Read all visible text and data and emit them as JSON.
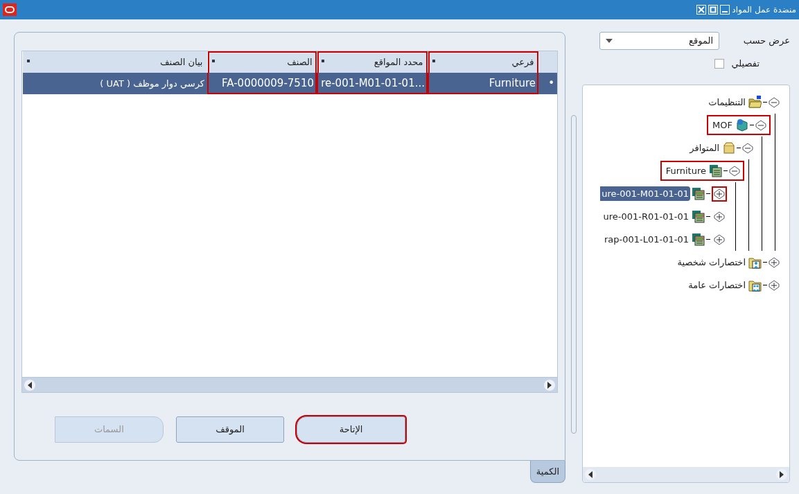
{
  "window": {
    "title": "منضدة عمل المواد"
  },
  "view_by": {
    "label": "عرض حسب",
    "value": "الموقع"
  },
  "details": {
    "label": "تفصيلي",
    "checked": false
  },
  "tree": [
    {
      "label": "التنظيمات",
      "kind": "root",
      "expanded": true,
      "selected": false,
      "highlighted": false,
      "children": [
        {
          "label": "MOF",
          "kind": "org",
          "expanded": true,
          "selected": false,
          "highlighted": true,
          "children": [
            {
              "label": "المتوافر",
              "kind": "stock",
              "expanded": true,
              "selected": false,
              "highlighted": false,
              "children": [
                {
                  "label": "Furniture",
                  "kind": "subinv",
                  "expanded": true,
                  "selected": false,
                  "highlighted": true,
                  "children": [
                    {
                      "label": "ure-001-M01-01-01",
                      "kind": "locator",
                      "expanded": false,
                      "selected": true,
                      "highlighted": false,
                      "toggle_highlighted": true
                    },
                    {
                      "label": "ure-001-R01-01-01",
                      "kind": "locator",
                      "expanded": false,
                      "selected": false,
                      "highlighted": false,
                      "toggle_highlighted": false
                    },
                    {
                      "label": "rap-001-L01-01-01",
                      "kind": "locator",
                      "expanded": false,
                      "selected": false,
                      "highlighted": false,
                      "toggle_highlighted": false
                    }
                  ]
                }
              ]
            }
          ]
        }
      ]
    },
    {
      "label": "اختصارات شخصية",
      "kind": "personal",
      "expanded": false,
      "selected": false,
      "highlighted": false
    },
    {
      "label": "اختصارات عامة",
      "kind": "public",
      "expanded": false,
      "selected": false,
      "highlighted": false
    }
  ],
  "table": {
    "columns": [
      {
        "label": "فرعي",
        "highlighted": true
      },
      {
        "label": "محدد المواقع",
        "highlighted": true
      },
      {
        "label": "الصنف",
        "highlighted": true
      },
      {
        "label": "بيان الصنف",
        "highlighted": false
      }
    ],
    "rows": [
      {
        "selected": true,
        "marker": "•",
        "cells": [
          "Furniture",
          "re-001-M01-01-01...",
          "FA-0000009-7510",
          "كرسي دوار موظف ( UAT )"
        ]
      }
    ]
  },
  "buttons": [
    {
      "label": "الإتاحة",
      "disabled": false,
      "highlighted": true
    },
    {
      "label": "الموقف",
      "disabled": false,
      "highlighted": false
    },
    {
      "label": "السمات",
      "disabled": true,
      "highlighted": false
    }
  ],
  "tabs": [
    {
      "label": "الكمية",
      "selected": true
    }
  ]
}
